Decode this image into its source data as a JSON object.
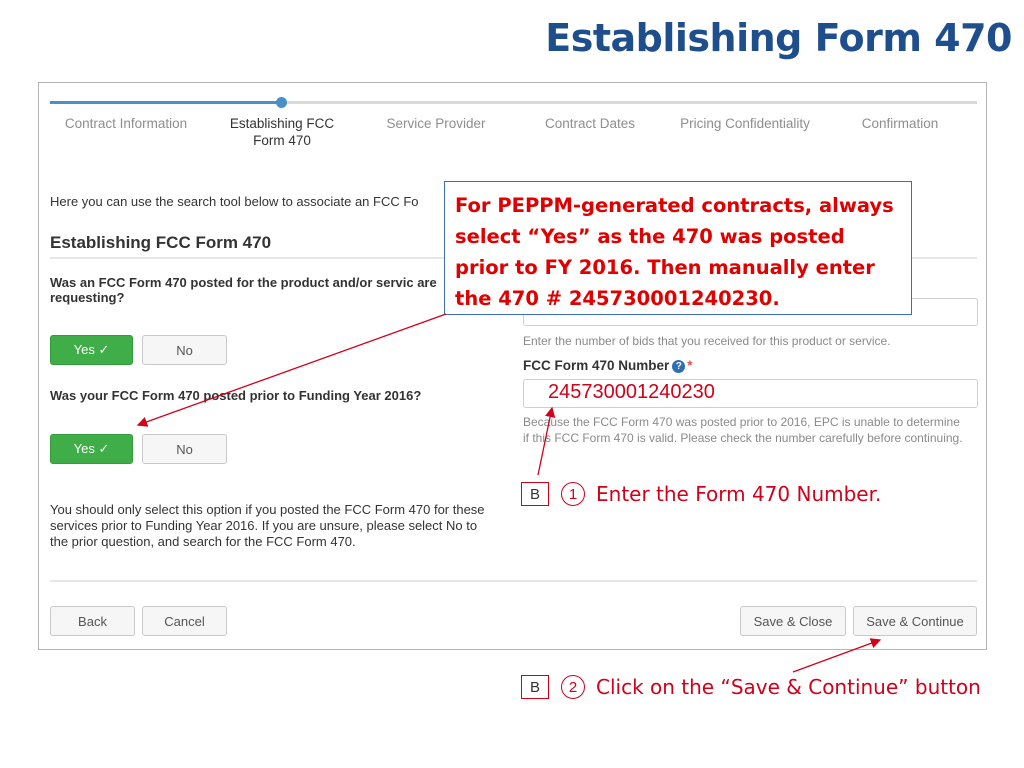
{
  "slide_title": "Establishing Form 470",
  "steps": [
    {
      "label": "Contract Information"
    },
    {
      "label": "Establishing FCC Form 470"
    },
    {
      "label": "Service Provider"
    },
    {
      "label": "Contract Dates"
    },
    {
      "label": "Pricing Confidentiality"
    },
    {
      "label": "Confirmation"
    }
  ],
  "intro_text": "Here you can use the search tool below to associate an FCC Fo",
  "section_heading": "Establishing FCC Form 470",
  "q1": {
    "text": "Was an FCC Form 470 posted for the product and/or servic are requesting?",
    "yes": "Yes ✓",
    "no": "No"
  },
  "q2": {
    "text": "Was your FCC Form 470 posted prior to Funding Year 2016?",
    "yes": "Yes ✓",
    "no": "No"
  },
  "note": "You should only select this option if you posted the FCC Form 470 for these services prior to Funding Year 2016.  If you are unsure, please select No to the prior question, and search for the FCC Form 470.",
  "bids_help": "Enter the number of bids that you received for this product or service.",
  "form470": {
    "label": "FCC Form 470 Number",
    "help_icon": "?",
    "required_mark": "*",
    "value": "245730001240230",
    "warning": "Because the FCC Form 470 was posted prior to 2016, EPC is unable to determine if this FCC Form 470 is valid. Please check the number carefully before continuing."
  },
  "footer": {
    "back": "Back",
    "cancel": "Cancel",
    "save_close": "Save & Close",
    "save_continue": "Save & Continue"
  },
  "callout": "For PEPPM-generated contracts, always select “Yes” as the 470 was posted prior to FY 2016.  Then manually enter the 470 # 245730001240230.",
  "annotations": [
    {
      "box": "B",
      "num": "1",
      "text": "Enter the Form 470 Number."
    },
    {
      "box": "B",
      "num": "2",
      "text": "Click on the “Save & Continue” button"
    }
  ],
  "colors": {
    "accent": "#4a90c8",
    "green": "#3fae49",
    "annotation_red": "#d0021b",
    "title_blue": "#1f4e8c"
  }
}
